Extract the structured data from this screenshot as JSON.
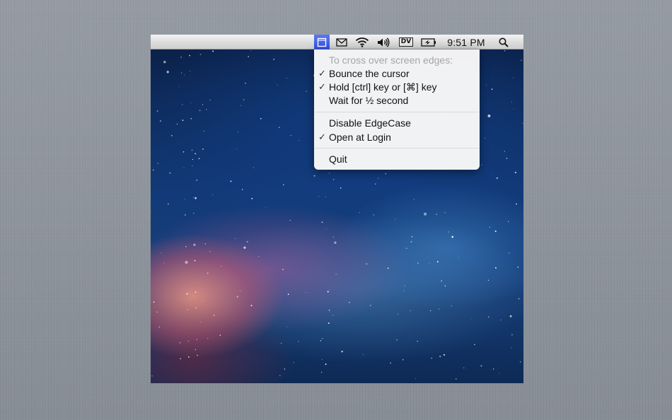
{
  "menubar": {
    "clock": "9:51 PM",
    "icons": [
      "edgecase-icon",
      "mail-icon",
      "wifi-icon",
      "volume-icon",
      "dv-icon",
      "battery-icon",
      "spotlight-icon"
    ],
    "dv_label": "DV",
    "active_color": "#3f5be6"
  },
  "menu": {
    "header": "To cross over screen edges:",
    "items": [
      {
        "label": "Bounce the cursor",
        "checked": true
      },
      {
        "label": "Hold [ctrl] key or [⌘] key",
        "checked": true
      },
      {
        "label": "Wait for ½ second",
        "checked": false
      },
      {
        "label": "Disable EdgeCase",
        "checked": false
      },
      {
        "label": "Open at Login",
        "checked": true
      },
      {
        "label": "Quit",
        "checked": false
      }
    ],
    "check_glyph": "✓"
  }
}
